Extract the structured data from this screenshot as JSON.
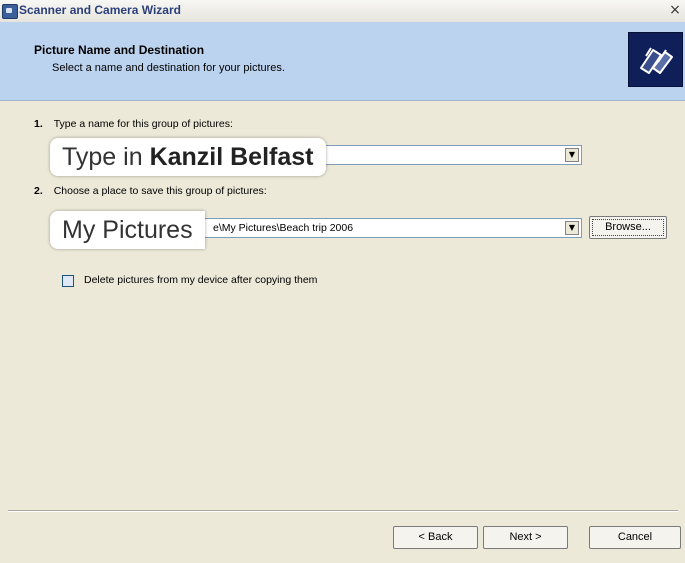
{
  "window": {
    "title": "Scanner and Camera Wizard",
    "close_glyph": "×"
  },
  "header": {
    "title": "Picture Name and Destination",
    "subtitle": "Select a name and destination for your pictures.",
    "logo_icon": "camera-scanner-wizard-icon"
  },
  "step1": {
    "number": "1.",
    "label": "Type a name for this group of pictures:",
    "value": ""
  },
  "step2": {
    "number": "2.",
    "label": "Choose a place to save this group of pictures:",
    "value": "e\\My Pictures\\Beach trip 2006",
    "browse_label": "Browse..."
  },
  "options": {
    "delete_label": "Delete pictures from my device after copying them",
    "delete_checked": false
  },
  "callouts": {
    "name_prefix": "Type in ",
    "name_value": "Kanzil Belfast",
    "place": "My Pictures"
  },
  "footer": {
    "back_label": "< Back",
    "next_label": "Next >",
    "cancel_label": "Cancel"
  },
  "colors": {
    "header_bg": "#bcd3ef",
    "dialog_bg": "#ece9d8",
    "logo_bg": "#0f1f5a"
  }
}
